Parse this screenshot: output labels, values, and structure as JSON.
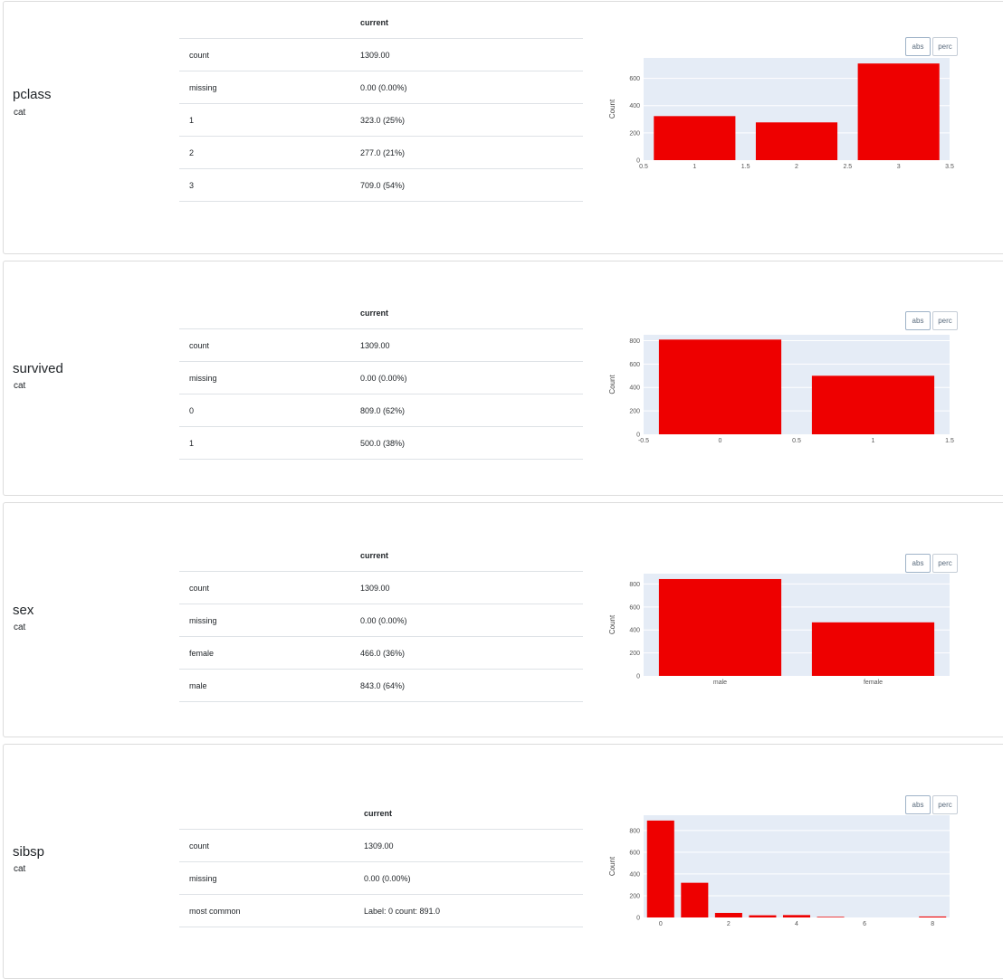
{
  "column_header": "current",
  "buttons": {
    "abs": "abs",
    "perc": "perc"
  },
  "colors": {
    "bar": "#ee0000",
    "plot_bg": "#e5ecf6",
    "grid": "#ffffff"
  },
  "features": [
    {
      "name": "pclass",
      "type": "cat",
      "rows": [
        {
          "k": "count",
          "v": "1309.00"
        },
        {
          "k": "missing",
          "v": "0.00 (0.00%)"
        },
        {
          "k": "1",
          "v": "323.0 (25%)"
        },
        {
          "k": "2",
          "v": "277.0 (21%)"
        },
        {
          "k": "3",
          "v": "709.0 (54%)"
        }
      ]
    },
    {
      "name": "survived",
      "type": "cat",
      "rows": [
        {
          "k": "count",
          "v": "1309.00"
        },
        {
          "k": "missing",
          "v": "0.00 (0.00%)"
        },
        {
          "k": "0",
          "v": "809.0 (62%)"
        },
        {
          "k": "1",
          "v": "500.0 (38%)"
        }
      ]
    },
    {
      "name": "sex",
      "type": "cat",
      "rows": [
        {
          "k": "count",
          "v": "1309.00"
        },
        {
          "k": "missing",
          "v": "0.00 (0.00%)"
        },
        {
          "k": "female",
          "v": "466.0 (36%)"
        },
        {
          "k": "male",
          "v": "843.0 (64%)"
        }
      ]
    },
    {
      "name": "sibsp",
      "type": "cat",
      "rows": [
        {
          "k": "count",
          "v": "1309.00"
        },
        {
          "k": "missing",
          "v": "0.00 (0.00%)"
        },
        {
          "k": "most common",
          "v": "Label: 0 count: 891.0"
        }
      ]
    }
  ],
  "chart_data": [
    {
      "type": "bar",
      "ylabel": "Count",
      "x": [
        1,
        2,
        3
      ],
      "values": [
        323,
        277,
        709
      ],
      "xlim": [
        0.5,
        3.5
      ],
      "ylim": [
        0,
        750
      ],
      "xticks": [
        "0.5",
        "1",
        "1.5",
        "2",
        "2.5",
        "3",
        "3.5"
      ],
      "yticks": [
        "0",
        "200",
        "400",
        "600"
      ]
    },
    {
      "type": "bar",
      "ylabel": "Count",
      "x": [
        0,
        1
      ],
      "values": [
        809,
        500
      ],
      "xlim": [
        -0.5,
        1.5
      ],
      "ylim": [
        0,
        850
      ],
      "xticks": [
        "-0.5",
        "0",
        "0.5",
        "1",
        "1.5"
      ],
      "yticks": [
        "0",
        "200",
        "400",
        "600",
        "800"
      ]
    },
    {
      "type": "bar",
      "ylabel": "Count",
      "categories": [
        "male",
        "female"
      ],
      "values": [
        843,
        466
      ],
      "ylim": [
        0,
        890
      ],
      "yticks": [
        "0",
        "200",
        "400",
        "600",
        "800"
      ]
    },
    {
      "type": "bar",
      "ylabel": "Count",
      "x": [
        0,
        1,
        2,
        3,
        4,
        5,
        8
      ],
      "values": [
        891,
        319,
        42,
        20,
        22,
        6,
        9
      ],
      "xlim": [
        -0.5,
        8.5
      ],
      "ylim": [
        0,
        940
      ],
      "xticks": [
        "0",
        "2",
        "4",
        "6",
        "8"
      ],
      "yticks": [
        "0",
        "200",
        "400",
        "600",
        "800"
      ]
    }
  ]
}
